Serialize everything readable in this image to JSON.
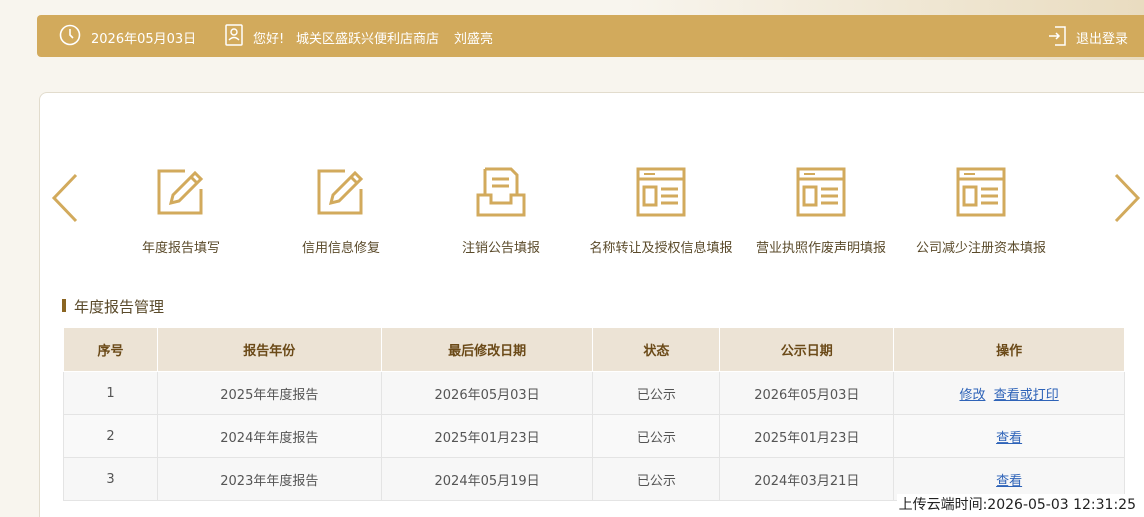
{
  "header": {
    "date": "2026年05月03日",
    "greeting": "您好!",
    "shop_name": "城关区盛跃兴便利店商店",
    "user_name": "刘盛亮",
    "logout_label": "退出登录"
  },
  "nav": {
    "items": [
      {
        "label": "年度报告填写",
        "icon": "edit-icon"
      },
      {
        "label": "信用信息修复",
        "icon": "edit-icon"
      },
      {
        "label": "注销公告填报",
        "icon": "inbox-icon"
      },
      {
        "label": "名称转让及授权信息填报",
        "icon": "document-icon"
      },
      {
        "label": "营业执照作废声明填报",
        "icon": "document-icon"
      },
      {
        "label": "公司减少注册资本填报",
        "icon": "document-icon"
      }
    ]
  },
  "section": {
    "title": "年度报告管理"
  },
  "table": {
    "headers": [
      "序号",
      "报告年份",
      "最后修改日期",
      "状态",
      "公示日期",
      "操作"
    ],
    "rows": [
      {
        "index": "1",
        "year": "2025年年度报告",
        "modified": "2026年05月03日",
        "status": "已公示",
        "published": "2026年05月03日",
        "action1": "修改",
        "action2": "查看或打印"
      },
      {
        "index": "2",
        "year": "2024年年度报告",
        "modified": "2025年01月23日",
        "status": "已公示",
        "published": "2025年01月23日",
        "action1": "查看"
      },
      {
        "index": "3",
        "year": "2023年年度报告",
        "modified": "2024年05月19日",
        "status": "已公示",
        "published": "2024年03月21日",
        "action1": "查看"
      }
    ]
  },
  "footer": {
    "timestamp": "上传云端时间:2026-05-03 12:31:25"
  },
  "colors": {
    "accent": "#d2aa5c",
    "link": "#2e63b8",
    "header_bg": "#ece3d5"
  }
}
